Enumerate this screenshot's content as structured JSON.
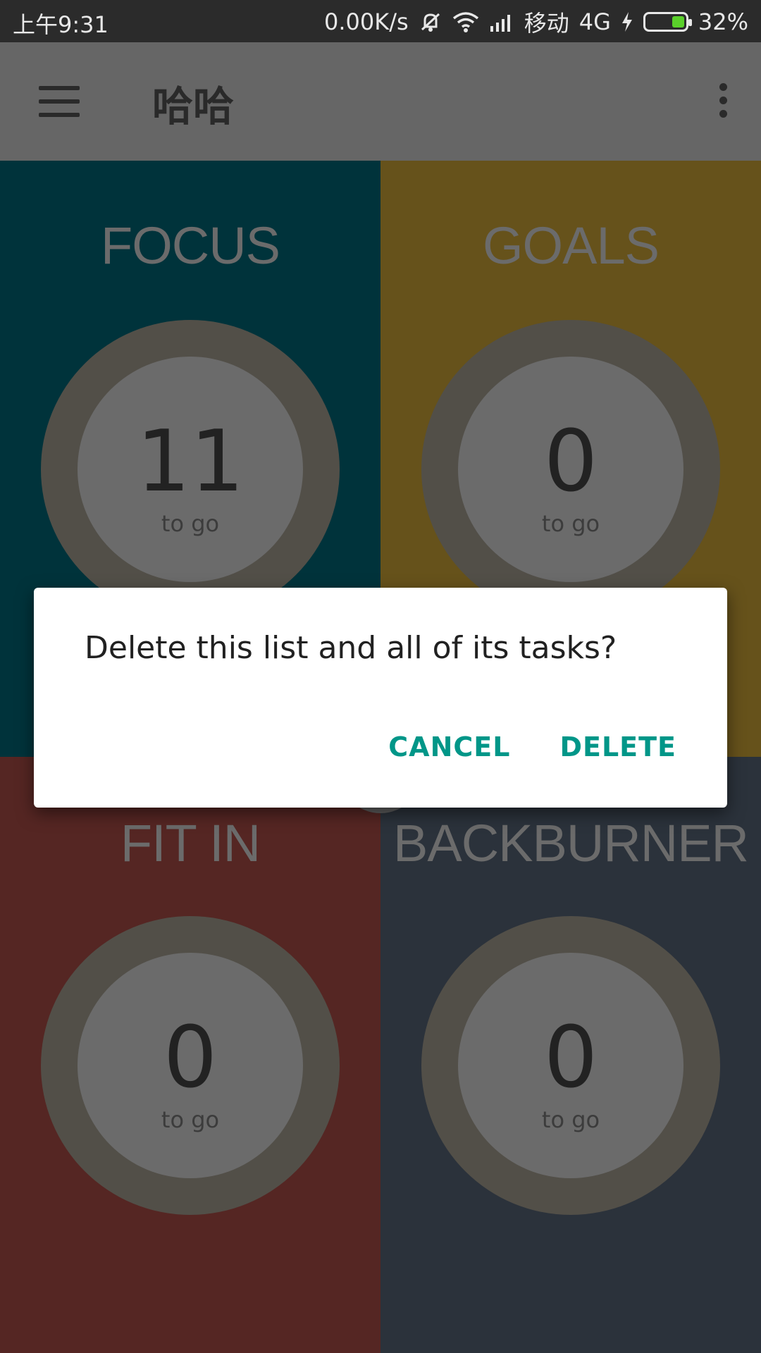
{
  "status_bar": {
    "time": "上午9:31",
    "net_speed": "0.00K/s",
    "carrier": "移动",
    "network": "4G",
    "battery": "32%",
    "battery_level": 0.32,
    "icons": [
      "mute-icon",
      "wifi-icon",
      "signal-icon",
      "charging-icon",
      "battery-icon"
    ]
  },
  "app_bar": {
    "title": "哈哈",
    "menu_icon": "hamburger-menu-icon",
    "overflow_icon": "more-vert-icon"
  },
  "lists": [
    {
      "name": "FOCUS",
      "count": "11",
      "caption": "to go",
      "color": "#00333b"
    },
    {
      "name": "GOALS",
      "count": "0",
      "caption": "to go",
      "color": "#66521b"
    },
    {
      "name": "FIT IN",
      "count": "0",
      "caption": "to go",
      "color": "#552623"
    },
    {
      "name": "BACKBURNER",
      "count": "0",
      "caption": "to go",
      "color": "#2b323b"
    }
  ],
  "dialog": {
    "message": "Delete this list and all of its tasks?",
    "cancel_label": "CANCEL",
    "delete_label": "DELETE",
    "accent_color": "#009688"
  }
}
